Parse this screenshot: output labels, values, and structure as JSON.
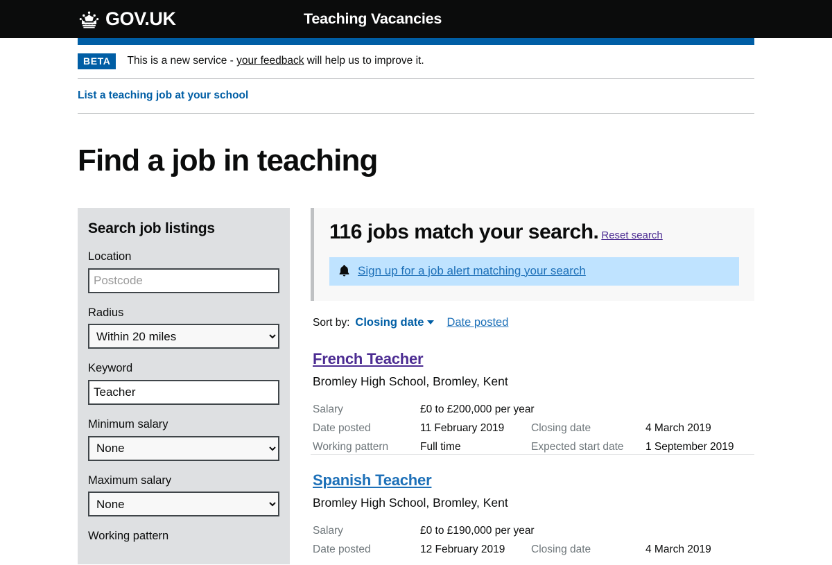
{
  "header": {
    "brand": "GOV.UK",
    "service_name": "Teaching Vacancies",
    "crown_icon": "crown-icon"
  },
  "phase_banner": {
    "tag": "BETA",
    "text_before": "This is a new service - ",
    "link": "your feedback",
    "text_after": " will help us to improve it."
  },
  "sub_nav": {
    "list_job_link": "List a teaching job at your school"
  },
  "page": {
    "title": "Find a job in teaching"
  },
  "sidebar": {
    "heading": "Search job listings",
    "fields": [
      {
        "label": "Location",
        "type": "text",
        "value": "",
        "placeholder": "Postcode"
      },
      {
        "label": "Radius",
        "type": "select",
        "value": "Within 20 miles"
      },
      {
        "label": "Keyword",
        "type": "text",
        "value": "Teacher",
        "placeholder": ""
      },
      {
        "label": "Minimum salary",
        "type": "select",
        "value": "None"
      },
      {
        "label": "Maximum salary",
        "type": "select",
        "value": "None"
      },
      {
        "label": "Working pattern",
        "type": "checkboxes",
        "value": ""
      }
    ]
  },
  "results": {
    "heading": "116 jobs match your search.",
    "reset_label": "Reset search",
    "alert": {
      "icon": "bell-icon",
      "link": "Sign up for a job alert matching your search"
    },
    "sort": {
      "label": "Sort by:",
      "active": "Closing date",
      "caret_icon": "chevron-down-icon",
      "other": "Date posted"
    },
    "labels": {
      "salary": "Salary",
      "date_posted": "Date posted",
      "closing_date": "Closing date",
      "working_pattern": "Working pattern",
      "expected_start_date": "Expected start date"
    },
    "jobs": [
      {
        "title": "French Teacher",
        "link_state": "visited",
        "school": "Bromley High School, Bromley, Kent",
        "salary": "£0 to £200,000 per year",
        "date_posted": "11 February 2019",
        "closing_date": "4 March 2019",
        "working_pattern": "Full time",
        "expected_start_date": "1 September 2019"
      },
      {
        "title": "Spanish Teacher",
        "link_state": "unvisited",
        "school": "Bromley High School, Bromley, Kent",
        "salary": "£0 to £190,000 per year",
        "date_posted": "12 February 2019",
        "closing_date": "4 March 2019",
        "working_pattern": "",
        "expected_start_date": ""
      }
    ]
  },
  "colors": {
    "header_black": "#0b0c0c",
    "govuk_blue": "#005ea5",
    "link_blue": "#1d70b8",
    "visited_purple": "#4c2c92",
    "sidebar_grey": "#dee0e2",
    "panel_grey": "#f8f8f8",
    "alert_blue": "#bfe3ff",
    "muted_text": "#6f777b"
  }
}
